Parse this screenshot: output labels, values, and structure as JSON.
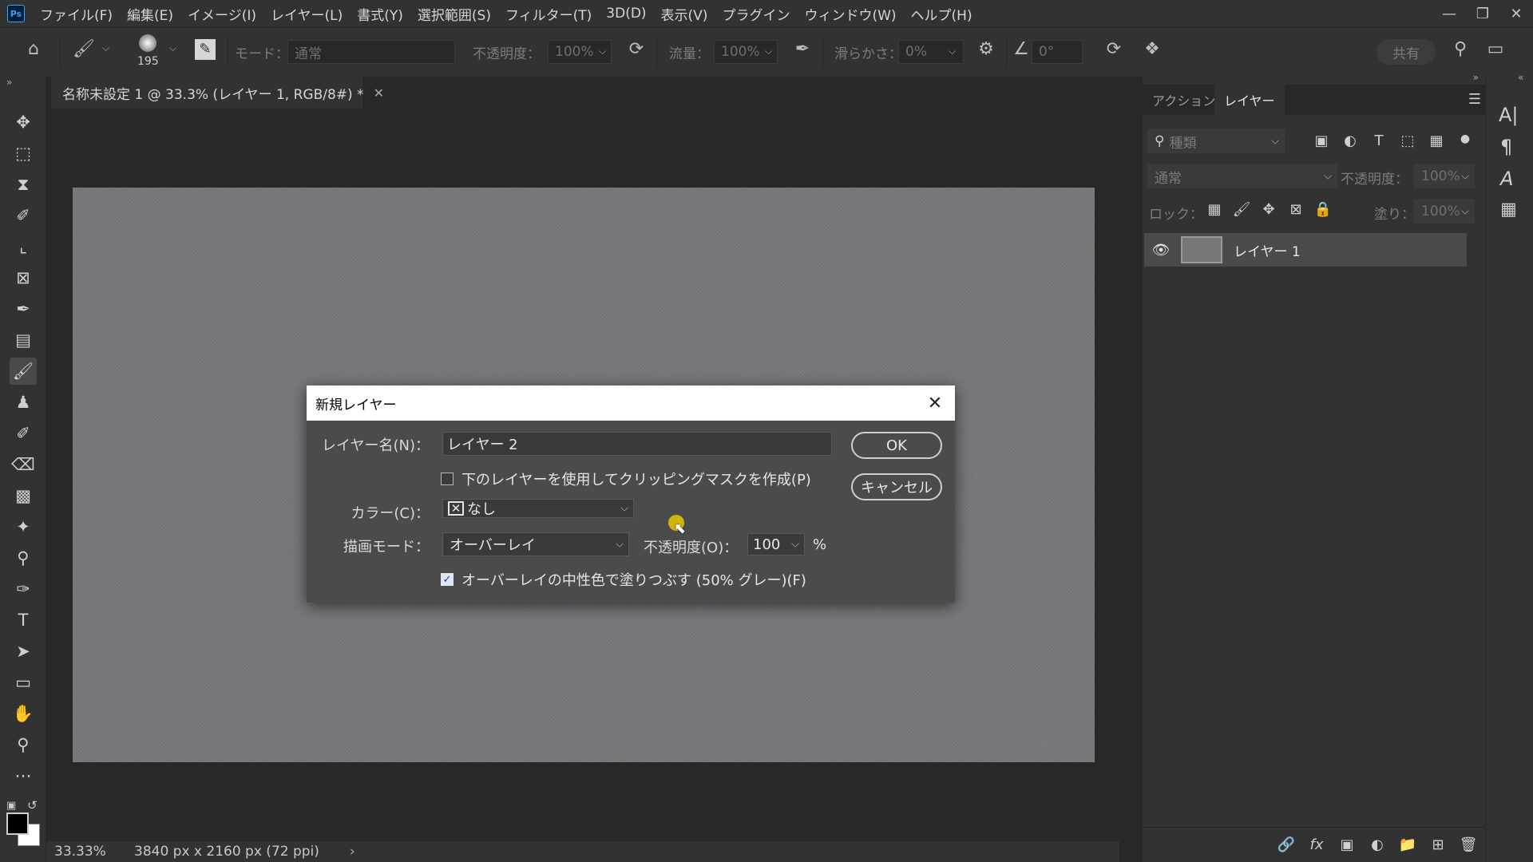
{
  "menubar": {
    "logo": "Ps",
    "items": [
      "ファイル(F)",
      "編集(E)",
      "イメージ(I)",
      "レイヤー(L)",
      "書式(Y)",
      "選択範囲(S)",
      "フィルター(T)",
      "3D(D)",
      "表示(V)",
      "プラグイン",
      "ウィンドウ(W)",
      "ヘルプ(H)"
    ],
    "window_controls": [
      "minimize",
      "restore",
      "close"
    ]
  },
  "options_bar": {
    "brush_size": "195",
    "mode_label": "モード：",
    "mode_value": "通常",
    "opacity_label": "不透明度：",
    "opacity_value": "100%",
    "flow_label": "流量：",
    "flow_value": "100%",
    "smoothing_label": "滑らかさ：",
    "smoothing_value": "0%",
    "angle_value": "0°",
    "share_label": "共有"
  },
  "document": {
    "tab_title": "名称未設定 1 @ 33.3% (レイヤー 1, RGB/8#) *",
    "zoom": "33.33%",
    "dimensions": "3840 px x 2160 px (72 ppi)"
  },
  "panel": {
    "tabs": [
      "アクション",
      "レイヤー"
    ],
    "active_tab": "レイヤー",
    "filter_placeholder": "種類",
    "blend_mode": "通常",
    "opacity_label": "不透明度：",
    "opacity_value": "100%",
    "lock_label": "ロック：",
    "fill_label": "塗り：",
    "fill_value": "100%",
    "layers": [
      {
        "name": "レイヤー 1",
        "visible": true
      }
    ]
  },
  "dialog": {
    "title": "新規レイヤー",
    "name_label": "レイヤー名(N)：",
    "name_value": "レイヤー 2",
    "clip_label": "下のレイヤーを使用してクリッピングマスクを作成(P)",
    "clip_checked": false,
    "color_label": "カラー(C)：",
    "color_value": "なし",
    "mode_label": "描画モード：",
    "mode_value": "オーバーレイ",
    "opacity_label": "不透明度(O)：",
    "opacity_value": "100",
    "percent": "%",
    "fill_neutral_label": "オーバーレイの中性色で塗りつぶす (50% グレー)(F)",
    "fill_neutral_checked": true,
    "ok_label": "OK",
    "cancel_label": "キャンセル"
  },
  "colors": {
    "ui_bg": "#323232",
    "workspace": "#282828",
    "dialog_bg": "#4b4b4b",
    "ps_blue": "#31a8ff"
  }
}
